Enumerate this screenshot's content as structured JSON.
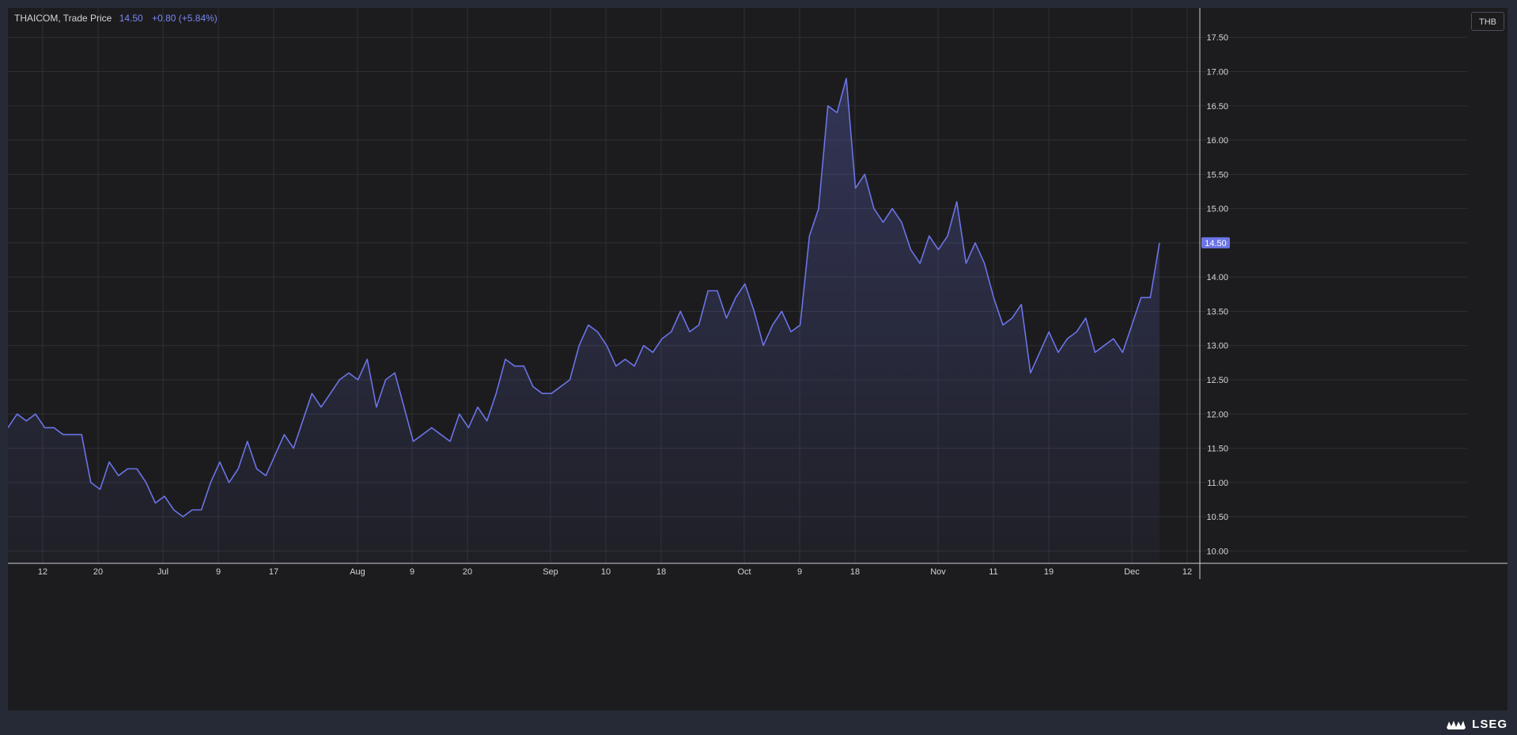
{
  "legend": {
    "instrument": "THAICOM, Trade Price",
    "last": "14.50",
    "change": "+0.80 (+5.84%)"
  },
  "currency_button": "THB",
  "price_tag": "14.50",
  "brand": "LSEG",
  "colors": {
    "line": "#6b74e6",
    "price_tag_bg": "#6b74e6",
    "background": "#1c1c1e",
    "frame": "#252a36",
    "grid": "#2e2f34",
    "text": "#d4d4d8"
  },
  "chart_data": {
    "type": "area",
    "series": [
      {
        "name": "THAICOM, Trade Price",
        "values": [
          11.8,
          12.0,
          11.9,
          12.0,
          11.8,
          11.8,
          11.7,
          11.7,
          11.7,
          11.0,
          10.9,
          11.3,
          11.1,
          11.2,
          11.2,
          11.0,
          10.7,
          10.8,
          10.6,
          10.5,
          10.6,
          10.6,
          11.0,
          11.3,
          11.0,
          11.2,
          11.6,
          11.2,
          11.1,
          11.4,
          11.7,
          11.5,
          11.9,
          12.3,
          12.1,
          12.3,
          12.5,
          12.6,
          12.5,
          12.8,
          12.1,
          12.5,
          12.6,
          12.1,
          11.6,
          11.7,
          11.8,
          11.7,
          11.6,
          12.0,
          11.8,
          12.1,
          11.9,
          12.3,
          12.8,
          12.7,
          12.7,
          12.4,
          12.3,
          12.3,
          12.4,
          12.5,
          13.0,
          13.3,
          13.2,
          13.0,
          12.7,
          12.8,
          12.7,
          13.0,
          12.9,
          13.1,
          13.2,
          13.5,
          13.2,
          13.3,
          13.8,
          13.8,
          13.4,
          13.7,
          13.9,
          13.5,
          13.0,
          13.3,
          13.5,
          13.2,
          13.3,
          14.6,
          15.0,
          16.5,
          16.4,
          16.9,
          15.3,
          15.5,
          15.0,
          14.8,
          15.0,
          14.8,
          14.4,
          14.2,
          14.6,
          14.4,
          14.6,
          15.1,
          14.2,
          14.5,
          14.2,
          13.7,
          13.3,
          13.4,
          13.6,
          12.6,
          12.9,
          13.2,
          12.9,
          13.1,
          13.2,
          13.4,
          12.9,
          13.0,
          13.1,
          12.9,
          13.3,
          13.7,
          13.7,
          14.5
        ]
      }
    ],
    "x_tick_labels": [
      "12",
      "20",
      "Jul",
      "9",
      "17",
      "Aug",
      "9",
      "20",
      "Sep",
      "10",
      "18",
      "Oct",
      "9",
      "18",
      "Nov",
      "11",
      "19",
      "Dec",
      "12"
    ],
    "y_tick_labels": [
      "10.00",
      "10.50",
      "11.00",
      "11.50",
      "12.00",
      "12.50",
      "13.00",
      "13.50",
      "14.00",
      "14.50",
      "15.00",
      "15.50",
      "16.00",
      "16.50",
      "17.00",
      "17.50"
    ],
    "ylim": [
      9.82,
      17.93
    ],
    "grid": true,
    "legend_position": "top-left",
    "currency": "THB"
  }
}
